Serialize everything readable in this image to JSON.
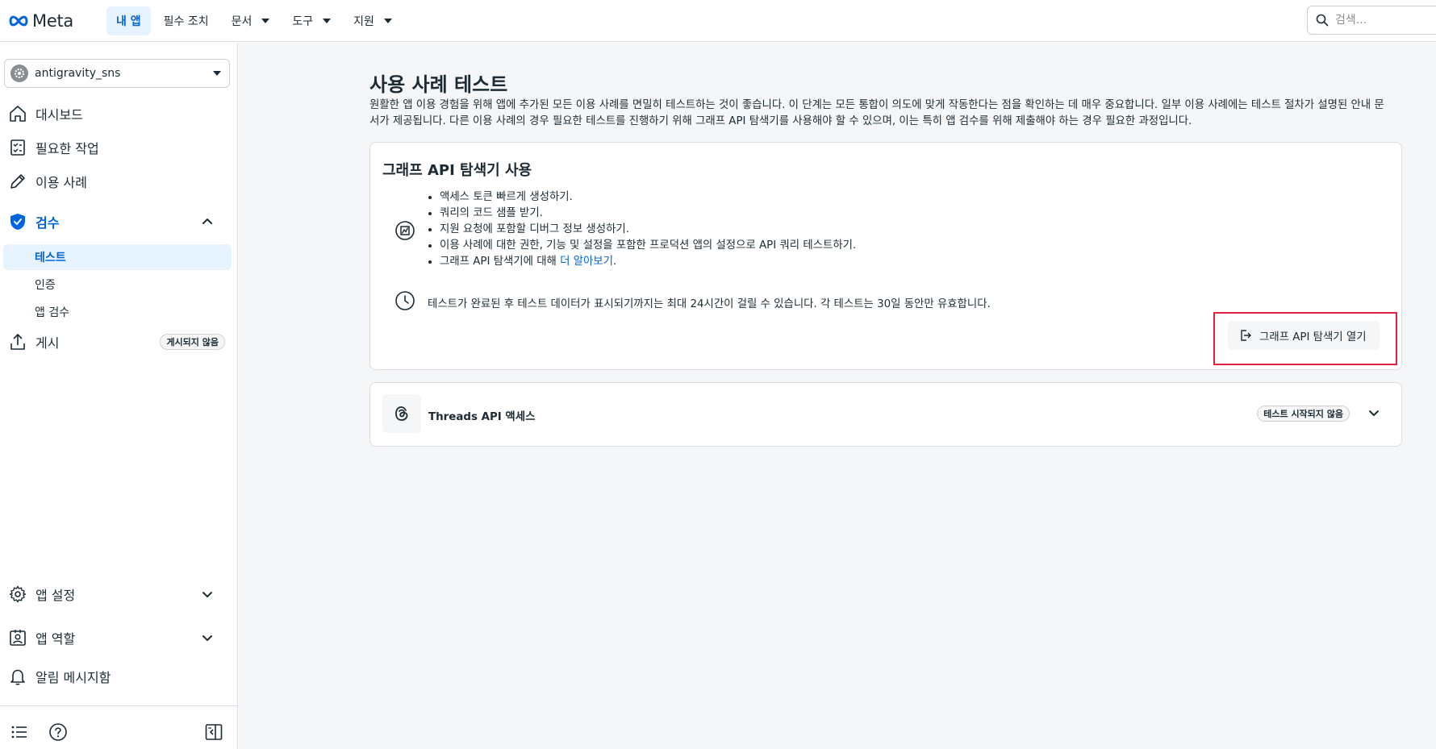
{
  "brand": {
    "name": "Meta",
    "color": "#0064e0"
  },
  "topnav": {
    "items": [
      {
        "label": "내 앱",
        "active": true,
        "dropdown": false
      },
      {
        "label": "필수 조치",
        "active": false,
        "dropdown": false
      },
      {
        "label": "문서",
        "active": false,
        "dropdown": true
      },
      {
        "label": "도구",
        "active": false,
        "dropdown": true
      },
      {
        "label": "지원",
        "active": false,
        "dropdown": true
      }
    ],
    "search_placeholder": "검색..."
  },
  "sidebar": {
    "app_name": "antigravity_sns",
    "items": [
      {
        "label": "대시보드",
        "icon": "home-icon"
      },
      {
        "label": "필요한 작업",
        "icon": "checklist-icon"
      },
      {
        "label": "이용 사례",
        "icon": "pencil-icon"
      },
      {
        "label": "검수",
        "icon": "shield-check-icon",
        "expanded": true
      },
      {
        "label": "게시",
        "icon": "upload-icon",
        "badge": "게시되지 않음"
      },
      {
        "label": "앱 설정",
        "icon": "gear-icon"
      },
      {
        "label": "앱 역할",
        "icon": "user-badge-icon"
      },
      {
        "label": "알림 메시지함",
        "icon": "bell-icon"
      }
    ],
    "sub_items": [
      {
        "label": "테스트",
        "active": true
      },
      {
        "label": "인증",
        "active": false
      },
      {
        "label": "앱 검수",
        "active": false
      }
    ]
  },
  "main": {
    "title": "사용 사례 테스트",
    "description": "원활한 앱 이용 경험을 위해 앱에 추가된 모든 이용 사례를 면밀히 테스트하는 것이 좋습니다. 이 단계는 모든 통합이 의도에 맞게 작동한다는 점을 확인하는 데 매우 중요합니다. 일부 이용 사례에는 테스트 절차가 설명된 안내 문서가 제공됩니다. 다른 이용 사례의 경우 필요한 테스트를 진행하기 위해 그래프 API 탐색기를 사용해야 할 수 있으며, 이는 특히 앱 검수를 위해 제출해야 하는 경우 필요한 과정입니다.",
    "explorer_card": {
      "title": "그래프 API 탐색기 사용",
      "bullets": [
        "액세스 토큰 빠르게 생성하기.",
        "쿼리의 코드 샘플 받기.",
        "지원 요청에 포함할 디버그 정보 생성하기.",
        "이용 사례에 대한 권한, 기능 및 설정을 포함한 프로덕션 앱의 설정으로 API 쿼리 테스트하기."
      ],
      "last_bullet_prefix": "그래프 API 탐색기에 대해 ",
      "learn_more": "더 알아보기",
      "last_bullet_suffix": ".",
      "note": "테스트가 완료된 후 테스트 데이터가 표시되기까지는 최대 24시간이 걸릴 수 있습니다. 각 테스트는 30일 동안만 유효합니다.",
      "open_button": "그래프 API 탐색기 열기"
    },
    "threads_card": {
      "label": "Threads API 액세스",
      "status": "테스트 시작되지 않음"
    }
  },
  "colors": {
    "highlight": "#e41e3f",
    "active_bg": "#e7f3ff"
  }
}
